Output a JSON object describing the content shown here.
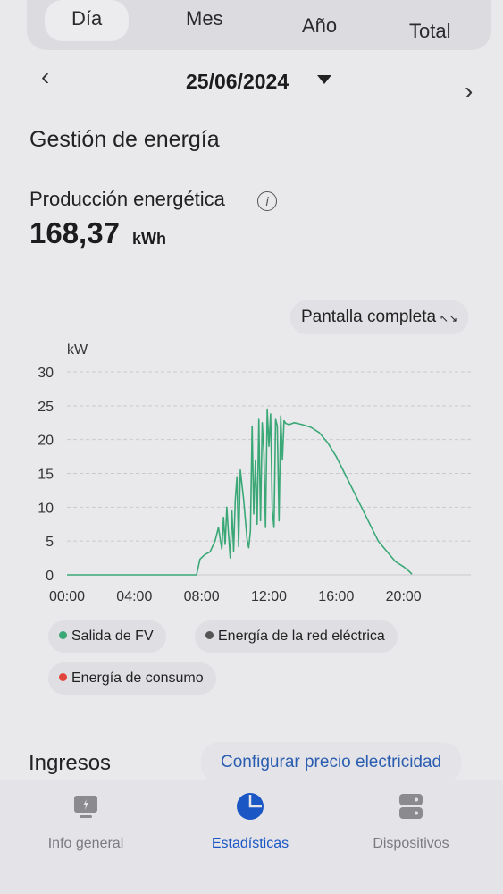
{
  "tabs": [
    {
      "label": "Día",
      "active": true
    },
    {
      "label": "Mes",
      "active": false
    },
    {
      "label": "Año",
      "active": false
    },
    {
      "label": "Total",
      "active": false
    }
  ],
  "date_selector": {
    "date": "25/06/2024",
    "prev_icon": "chevron-left-icon",
    "next_icon": "chevron-right-icon"
  },
  "section": {
    "title": "Gestión de energía"
  },
  "production": {
    "label": "Producción energética",
    "value": "168,37",
    "unit": "kWh"
  },
  "fullscreen": {
    "label": "Pantalla completa"
  },
  "chart_data": {
    "type": "line",
    "ylabel": "kW",
    "ylim": [
      0,
      30
    ],
    "yticks": [
      "0",
      "5",
      "10",
      "15",
      "20",
      "25",
      "30"
    ],
    "xticks": [
      "00:00",
      "04:00",
      "08:00",
      "12:00",
      "16:00",
      "20:00"
    ],
    "xlim": [
      0,
      24
    ],
    "grid": true,
    "series": [
      {
        "name": "Salida de FV",
        "color": "#3aa876",
        "x": [
          0,
          7.7,
          7.9,
          8.2,
          8.5,
          8.8,
          9.0,
          9.2,
          9.3,
          9.4,
          9.5,
          9.6,
          9.7,
          9.8,
          9.9,
          10.0,
          10.1,
          10.2,
          10.3,
          10.5,
          10.7,
          10.8,
          10.9,
          11.0,
          11.1,
          11.2,
          11.3,
          11.4,
          11.5,
          11.6,
          11.7,
          11.8,
          11.9,
          12.0,
          12.1,
          12.2,
          12.3,
          12.4,
          12.5,
          12.6,
          12.7,
          12.8,
          12.9,
          13.0,
          13.2,
          13.5,
          14.0,
          14.5,
          15.0,
          15.5,
          16.0,
          16.5,
          17.0,
          17.5,
          18.0,
          18.5,
          19.0,
          19.5,
          20.0,
          20.3,
          20.5
        ],
        "y": [
          0,
          0,
          2.3,
          3.0,
          3.4,
          5.0,
          7.0,
          3.8,
          8.5,
          4.5,
          10.0,
          6.0,
          2.5,
          9.5,
          3.5,
          11.0,
          14.5,
          4.2,
          15.5,
          11.0,
          5.3,
          4.0,
          6.5,
          22.0,
          9.0,
          17.0,
          7.5,
          23.0,
          8.0,
          22.5,
          18.0,
          7.0,
          24.5,
          19.0,
          23.8,
          9.5,
          7.0,
          23.0,
          22.0,
          8.0,
          23.5,
          17.0,
          22.8,
          22.4,
          22.2,
          22.5,
          22.2,
          21.8,
          21.0,
          19.5,
          17.5,
          15.0,
          12.5,
          10.0,
          7.5,
          5.0,
          3.5,
          2.0,
          1.2,
          0.6,
          0.1
        ]
      }
    ],
    "legend": [
      {
        "label": "Salida de FV",
        "color": "#3aa876"
      },
      {
        "label": "Energía de la red eléctrica",
        "color": "#555555"
      },
      {
        "label": "Energía de consumo",
        "color": "#e0443a"
      }
    ]
  },
  "income": {
    "title": "Ingresos",
    "config_link": "Configurar precio electricidad"
  },
  "bottom_nav": [
    {
      "label": "Info general",
      "icon": "monitor-icon",
      "active": false
    },
    {
      "label": "Estadísticas",
      "icon": "pie-chart-icon",
      "active": true
    },
    {
      "label": "Dispositivos",
      "icon": "server-icon",
      "active": false
    }
  ],
  "colors": {
    "accent": "#1a56c4",
    "pv": "#3aa876",
    "grid": "#555555",
    "consumption": "#e0443a"
  }
}
